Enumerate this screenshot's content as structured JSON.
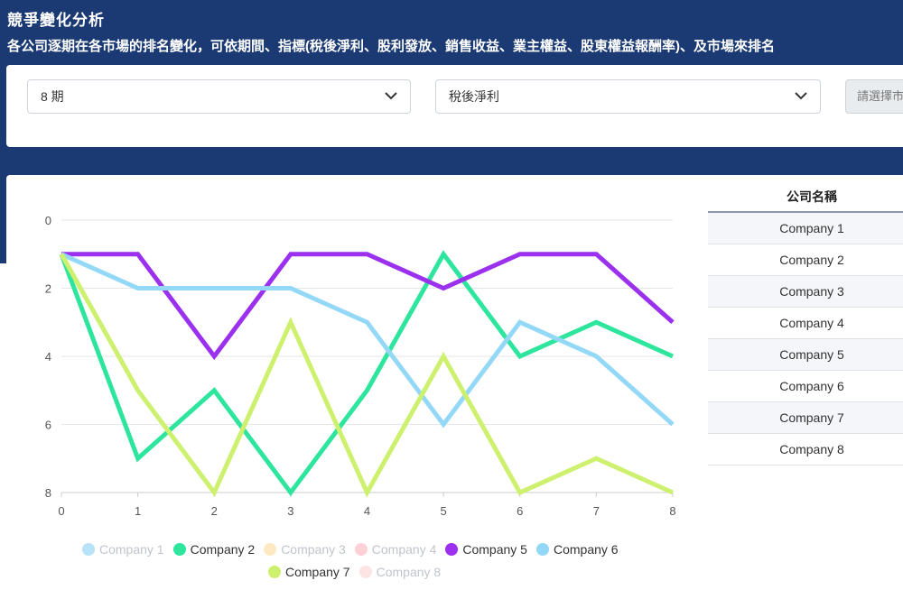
{
  "header": {
    "title": "競爭變化分析",
    "subtitle": "各公司逐期在各市場的排名變化，可依期間、指標(稅後淨利、股利發放、銷售收益、業主權益、股東權益報酬率)、及市場來排名"
  },
  "filters": {
    "period": "8 期",
    "metric": "稅後淨利",
    "market_placeholder": "請選擇市場"
  },
  "colors": {
    "banner": "#1b3a73"
  },
  "chart_data": {
    "type": "line",
    "x": [
      0,
      1,
      2,
      3,
      4,
      5,
      6,
      7,
      8
    ],
    "xlim": [
      0,
      8
    ],
    "ylim": [
      0,
      8
    ],
    "y_inverted": true,
    "y_ticks": [
      0,
      2,
      4,
      6,
      8
    ],
    "x_ticks": [
      0,
      1,
      2,
      3,
      4,
      5,
      6,
      7,
      8
    ],
    "grid": "horizontal",
    "legend_position": "bottom",
    "series": [
      {
        "name": "Company 1",
        "color": "#b7e2f8",
        "visible": false,
        "values": []
      },
      {
        "name": "Company 2",
        "color": "#2ee59d",
        "visible": true,
        "values": [
          1,
          7,
          5,
          8,
          5,
          1,
          4,
          3,
          4
        ]
      },
      {
        "name": "Company 3",
        "color": "#ffe9c2",
        "visible": false,
        "values": []
      },
      {
        "name": "Company 4",
        "color": "#ffd0d6",
        "visible": false,
        "values": []
      },
      {
        "name": "Company 5",
        "color": "#9b30ee",
        "visible": true,
        "values": [
          1,
          1,
          4,
          1,
          1,
          2,
          1,
          1,
          3
        ]
      },
      {
        "name": "Company 6",
        "color": "#93d8f7",
        "visible": true,
        "values": [
          1,
          2,
          2,
          2,
          3,
          6,
          3,
          4,
          6
        ]
      },
      {
        "name": "Company 7",
        "color": "#cdf06e",
        "visible": true,
        "values": [
          1,
          5,
          8,
          3,
          8,
          4,
          8,
          7,
          8
        ]
      },
      {
        "name": "Company 8",
        "color": "#fce4e4",
        "visible": false,
        "values": []
      }
    ]
  },
  "table": {
    "header": "公司名稱",
    "rows": [
      "Company 1",
      "Company 2",
      "Company 3",
      "Company 4",
      "Company 5",
      "Company 6",
      "Company 7",
      "Company 8"
    ]
  }
}
